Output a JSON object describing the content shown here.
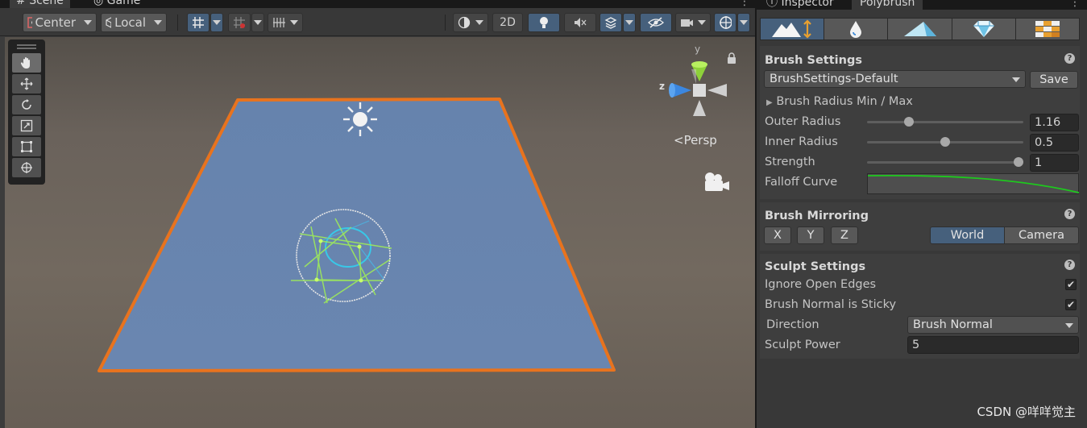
{
  "scene_tabs": {
    "scene": "Scene",
    "game": "Game"
  },
  "toolbar": {
    "pivot": "Center",
    "space": "Local",
    "two_d": "2D"
  },
  "gizmo": {
    "y": "y",
    "z": "z"
  },
  "persp_label": "<Persp",
  "inspector_tabs": {
    "inspector": "Inspector",
    "polybrush": "Polybrush"
  },
  "mode_icons": [
    "sculpt-mode-icon",
    "smooth-mode-icon",
    "paint-vertex-mode-icon",
    "prefab-mode-icon",
    "texture-mode-icon"
  ],
  "brush_settings": {
    "title": "Brush Settings",
    "preset": "BrushSettings-Default",
    "save": "Save",
    "radius_foldout": "Brush Radius Min / Max",
    "outer_radius_label": "Outer Radius",
    "outer_radius": "1.16",
    "outer_radius_fraction": 0.25,
    "inner_radius_label": "Inner Radius",
    "inner_radius": "0.5",
    "inner_radius_fraction": 0.5,
    "strength_label": "Strength",
    "strength": "1",
    "strength_fraction": 1.0,
    "falloff_label": "Falloff Curve"
  },
  "brush_mirroring": {
    "title": "Brush Mirroring",
    "x": "X",
    "y": "Y",
    "z": "Z",
    "world": "World",
    "camera": "Camera"
  },
  "sculpt_settings": {
    "title": "Sculpt Settings",
    "ignore_open_edges": "Ignore Open Edges",
    "ignore_open_edges_checked": true,
    "normal_sticky": "Brush Normal is Sticky",
    "normal_sticky_checked": true,
    "direction_label": "Direction",
    "direction": "Brush Normal",
    "power_label": "Sculpt Power",
    "power": "5"
  },
  "watermark": "CSDN @咩咩觉主",
  "colors": {
    "accent": "#46607c",
    "selection_outline": "#e8731e",
    "plane": "#6683ad",
    "curve": "#1ec81e"
  }
}
